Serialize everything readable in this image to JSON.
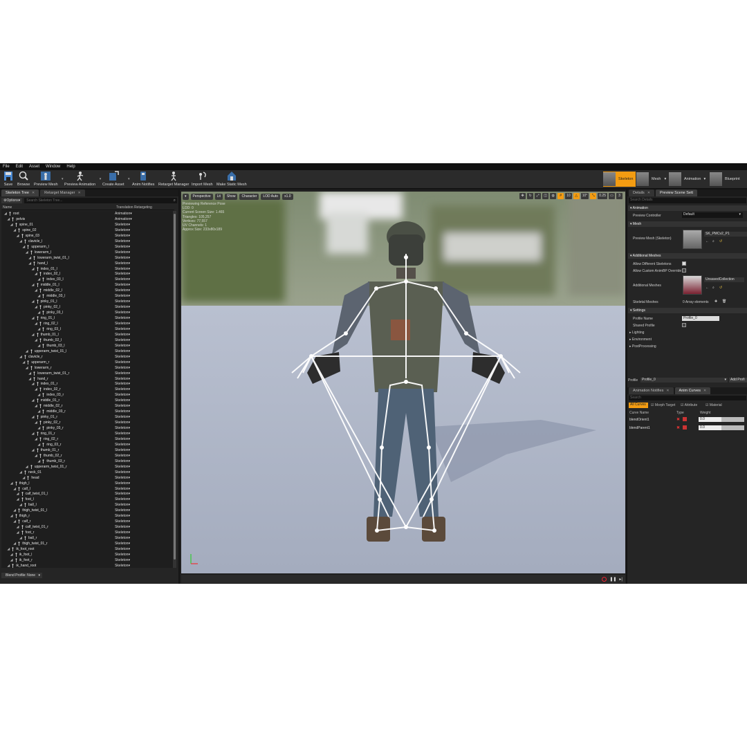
{
  "menu": [
    "File",
    "Edit",
    "Asset",
    "Window",
    "Help"
  ],
  "toolbar": {
    "save": "Save",
    "browse": "Browse",
    "preview_mesh": "Preview Mesh",
    "preview_animation": "Preview Animation",
    "create_asset": "Create Asset",
    "anim_notifies": "Anim Notifies",
    "retarget_manager": "Retarget Manager",
    "import_mesh": "Import Mesh",
    "make_static_mesh": "Make Static Mesh"
  },
  "modes": {
    "skeleton": "Skeleton",
    "mesh": "Mesh",
    "animation": "Animation",
    "blueprint": "Blueprint"
  },
  "left": {
    "tab1": "Skeleton Tree",
    "tab2": "Retarget Manager",
    "options": "Options",
    "search_placeholder": "Search Skeleton Tree...",
    "col_name": "Name",
    "col_retarget": "Translation Retargeting",
    "blend_profile": "Blend Profile: None",
    "bones": [
      {
        "name": "root",
        "depth": 0,
        "rt": "Animation"
      },
      {
        "name": "pelvis",
        "depth": 1,
        "rt": "Animation"
      },
      {
        "name": "spine_01",
        "depth": 2,
        "rt": "Skeleton"
      },
      {
        "name": "spine_02",
        "depth": 3,
        "rt": "Skeleton"
      },
      {
        "name": "spine_03",
        "depth": 4,
        "rt": "Skeleton"
      },
      {
        "name": "clavicle_l",
        "depth": 5,
        "rt": "Skeleton"
      },
      {
        "name": "upperarm_l",
        "depth": 6,
        "rt": "Skeleton"
      },
      {
        "name": "lowerarm_l",
        "depth": 7,
        "rt": "Skeleton"
      },
      {
        "name": "lowerarm_twist_01_l",
        "depth": 8,
        "rt": "Skeleton"
      },
      {
        "name": "hand_l",
        "depth": 8,
        "rt": "Skeleton"
      },
      {
        "name": "index_01_l",
        "depth": 9,
        "rt": "Skeleton"
      },
      {
        "name": "index_02_l",
        "depth": 10,
        "rt": "Skeleton"
      },
      {
        "name": "index_03_l",
        "depth": 11,
        "rt": "Skeleton"
      },
      {
        "name": "middle_01_l",
        "depth": 9,
        "rt": "Skeleton"
      },
      {
        "name": "middle_02_l",
        "depth": 10,
        "rt": "Skeleton"
      },
      {
        "name": "middle_03_l",
        "depth": 11,
        "rt": "Skeleton"
      },
      {
        "name": "pinky_01_l",
        "depth": 9,
        "rt": "Skeleton"
      },
      {
        "name": "pinky_02_l",
        "depth": 10,
        "rt": "Skeleton"
      },
      {
        "name": "pinky_03_l",
        "depth": 11,
        "rt": "Skeleton"
      },
      {
        "name": "ring_01_l",
        "depth": 9,
        "rt": "Skeleton"
      },
      {
        "name": "ring_02_l",
        "depth": 10,
        "rt": "Skeleton"
      },
      {
        "name": "ring_03_l",
        "depth": 11,
        "rt": "Skeleton"
      },
      {
        "name": "thumb_01_l",
        "depth": 9,
        "rt": "Skeleton"
      },
      {
        "name": "thumb_02_l",
        "depth": 10,
        "rt": "Skeleton"
      },
      {
        "name": "thumb_03_l",
        "depth": 11,
        "rt": "Skeleton"
      },
      {
        "name": "upperarm_twist_01_l",
        "depth": 7,
        "rt": "Skeleton"
      },
      {
        "name": "clavicle_r",
        "depth": 5,
        "rt": "Skeleton"
      },
      {
        "name": "upperarm_r",
        "depth": 6,
        "rt": "Skeleton"
      },
      {
        "name": "lowerarm_r",
        "depth": 7,
        "rt": "Skeleton"
      },
      {
        "name": "lowerarm_twist_01_r",
        "depth": 8,
        "rt": "Skeleton"
      },
      {
        "name": "hand_r",
        "depth": 8,
        "rt": "Skeleton"
      },
      {
        "name": "index_01_r",
        "depth": 9,
        "rt": "Skeleton"
      },
      {
        "name": "index_02_r",
        "depth": 10,
        "rt": "Skeleton"
      },
      {
        "name": "index_03_r",
        "depth": 11,
        "rt": "Skeleton"
      },
      {
        "name": "middle_01_r",
        "depth": 9,
        "rt": "Skeleton"
      },
      {
        "name": "middle_02_r",
        "depth": 10,
        "rt": "Skeleton"
      },
      {
        "name": "middle_03_r",
        "depth": 11,
        "rt": "Skeleton"
      },
      {
        "name": "pinky_01_r",
        "depth": 9,
        "rt": "Skeleton"
      },
      {
        "name": "pinky_02_r",
        "depth": 10,
        "rt": "Skeleton"
      },
      {
        "name": "pinky_03_r",
        "depth": 11,
        "rt": "Skeleton"
      },
      {
        "name": "ring_01_r",
        "depth": 9,
        "rt": "Skeleton"
      },
      {
        "name": "ring_02_r",
        "depth": 10,
        "rt": "Skeleton"
      },
      {
        "name": "ring_03_r",
        "depth": 11,
        "rt": "Skeleton"
      },
      {
        "name": "thumb_01_r",
        "depth": 9,
        "rt": "Skeleton"
      },
      {
        "name": "thumb_02_r",
        "depth": 10,
        "rt": "Skeleton"
      },
      {
        "name": "thumb_03_r",
        "depth": 11,
        "rt": "Skeleton"
      },
      {
        "name": "upperarm_twist_01_r",
        "depth": 7,
        "rt": "Skeleton"
      },
      {
        "name": "neck_01",
        "depth": 5,
        "rt": "Skeleton"
      },
      {
        "name": "head",
        "depth": 6,
        "rt": "Skeleton"
      },
      {
        "name": "thigh_l",
        "depth": 2,
        "rt": "Skeleton"
      },
      {
        "name": "calf_l",
        "depth": 3,
        "rt": "Skeleton"
      },
      {
        "name": "calf_twist_01_l",
        "depth": 4,
        "rt": "Skeleton"
      },
      {
        "name": "foot_l",
        "depth": 4,
        "rt": "Skeleton"
      },
      {
        "name": "ball_l",
        "depth": 5,
        "rt": "Skeleton"
      },
      {
        "name": "thigh_twist_01_l",
        "depth": 3,
        "rt": "Skeleton"
      },
      {
        "name": "thigh_r",
        "depth": 2,
        "rt": "Skeleton"
      },
      {
        "name": "calf_r",
        "depth": 3,
        "rt": "Skeleton"
      },
      {
        "name": "calf_twist_01_r",
        "depth": 4,
        "rt": "Skeleton"
      },
      {
        "name": "foot_r",
        "depth": 4,
        "rt": "Skeleton"
      },
      {
        "name": "ball_r",
        "depth": 5,
        "rt": "Skeleton"
      },
      {
        "name": "thigh_twist_01_r",
        "depth": 3,
        "rt": "Skeleton"
      },
      {
        "name": "ik_foot_root",
        "depth": 1,
        "rt": "Skeleton"
      },
      {
        "name": "ik_foot_l",
        "depth": 2,
        "rt": "Skeleton"
      },
      {
        "name": "ik_foot_r",
        "depth": 2,
        "rt": "Skeleton"
      },
      {
        "name": "ik_hand_root",
        "depth": 1,
        "rt": "Skeleton"
      }
    ]
  },
  "viewport": {
    "perspective": "Perspective",
    "lit": "Lit",
    "show": "Show",
    "character": "Character",
    "lod": "LOD Auto",
    "speed": "x1.0",
    "grid_value": "10",
    "angle_value": "10°",
    "scale_value": "0.25",
    "cam_speed": "3",
    "info": [
      "Previewing Reference Pose",
      "LOD: 0",
      "Current Screen Size: 1.465",
      "Triangles: 105,257",
      "Vertices: 77,557",
      "UV Channels: 1",
      "Approx Size: 233x80x189"
    ]
  },
  "right": {
    "tab_details": "Details",
    "tab_preview": "Preview Scene Sett",
    "search_details": "Search Details",
    "sec_animation": "Animation",
    "preview_controller_label": "Preview Controller",
    "preview_controller_value": "Default",
    "sec_mesh": "Mesh",
    "preview_mesh_label": "Preview Mesh (Skeleton)",
    "preview_mesh_value": "SK_PMCv2_P1",
    "sec_additional": "Additional Meshes",
    "allow_diff": "Allow Different Skeletons",
    "allow_custom": "Allow Custom AnimBP Override",
    "additional_meshes_label": "Additional Meshes",
    "additional_meshes_value": "UnsavedCollection",
    "skeletal_meshes_label": "Skeletal Meshes",
    "skeletal_meshes_value": "0 Array elements",
    "sec_settings": "Settings",
    "profile_name_label": "Profile Name",
    "profile_name_value": "Profile_0",
    "shared_profile": "Shared Profile",
    "lighting": "Lighting",
    "environment": "Environment",
    "postprocessing": "PostProcessing",
    "profile_label": "Profile",
    "profile_value": "Profile_0",
    "add_profile": "Add Profi",
    "tab_notifies": "Animation Notifies",
    "tab_curves": "Anim Curves",
    "search_curves": "Search",
    "filter_all": "All Curves",
    "filter_morph": "Morph Target",
    "filter_attr": "Attribute",
    "filter_mat": "Material",
    "col_curve": "Curve Name",
    "col_type": "Type",
    "col_weight": "Weight",
    "curves": [
      {
        "name": "blendOrient1",
        "weight": "0.0"
      },
      {
        "name": "blendParent1",
        "weight": "0.0"
      }
    ]
  },
  "colors": {
    "accent": "#f39c12",
    "panel": "#252525",
    "tree": "#1e1e1e"
  }
}
